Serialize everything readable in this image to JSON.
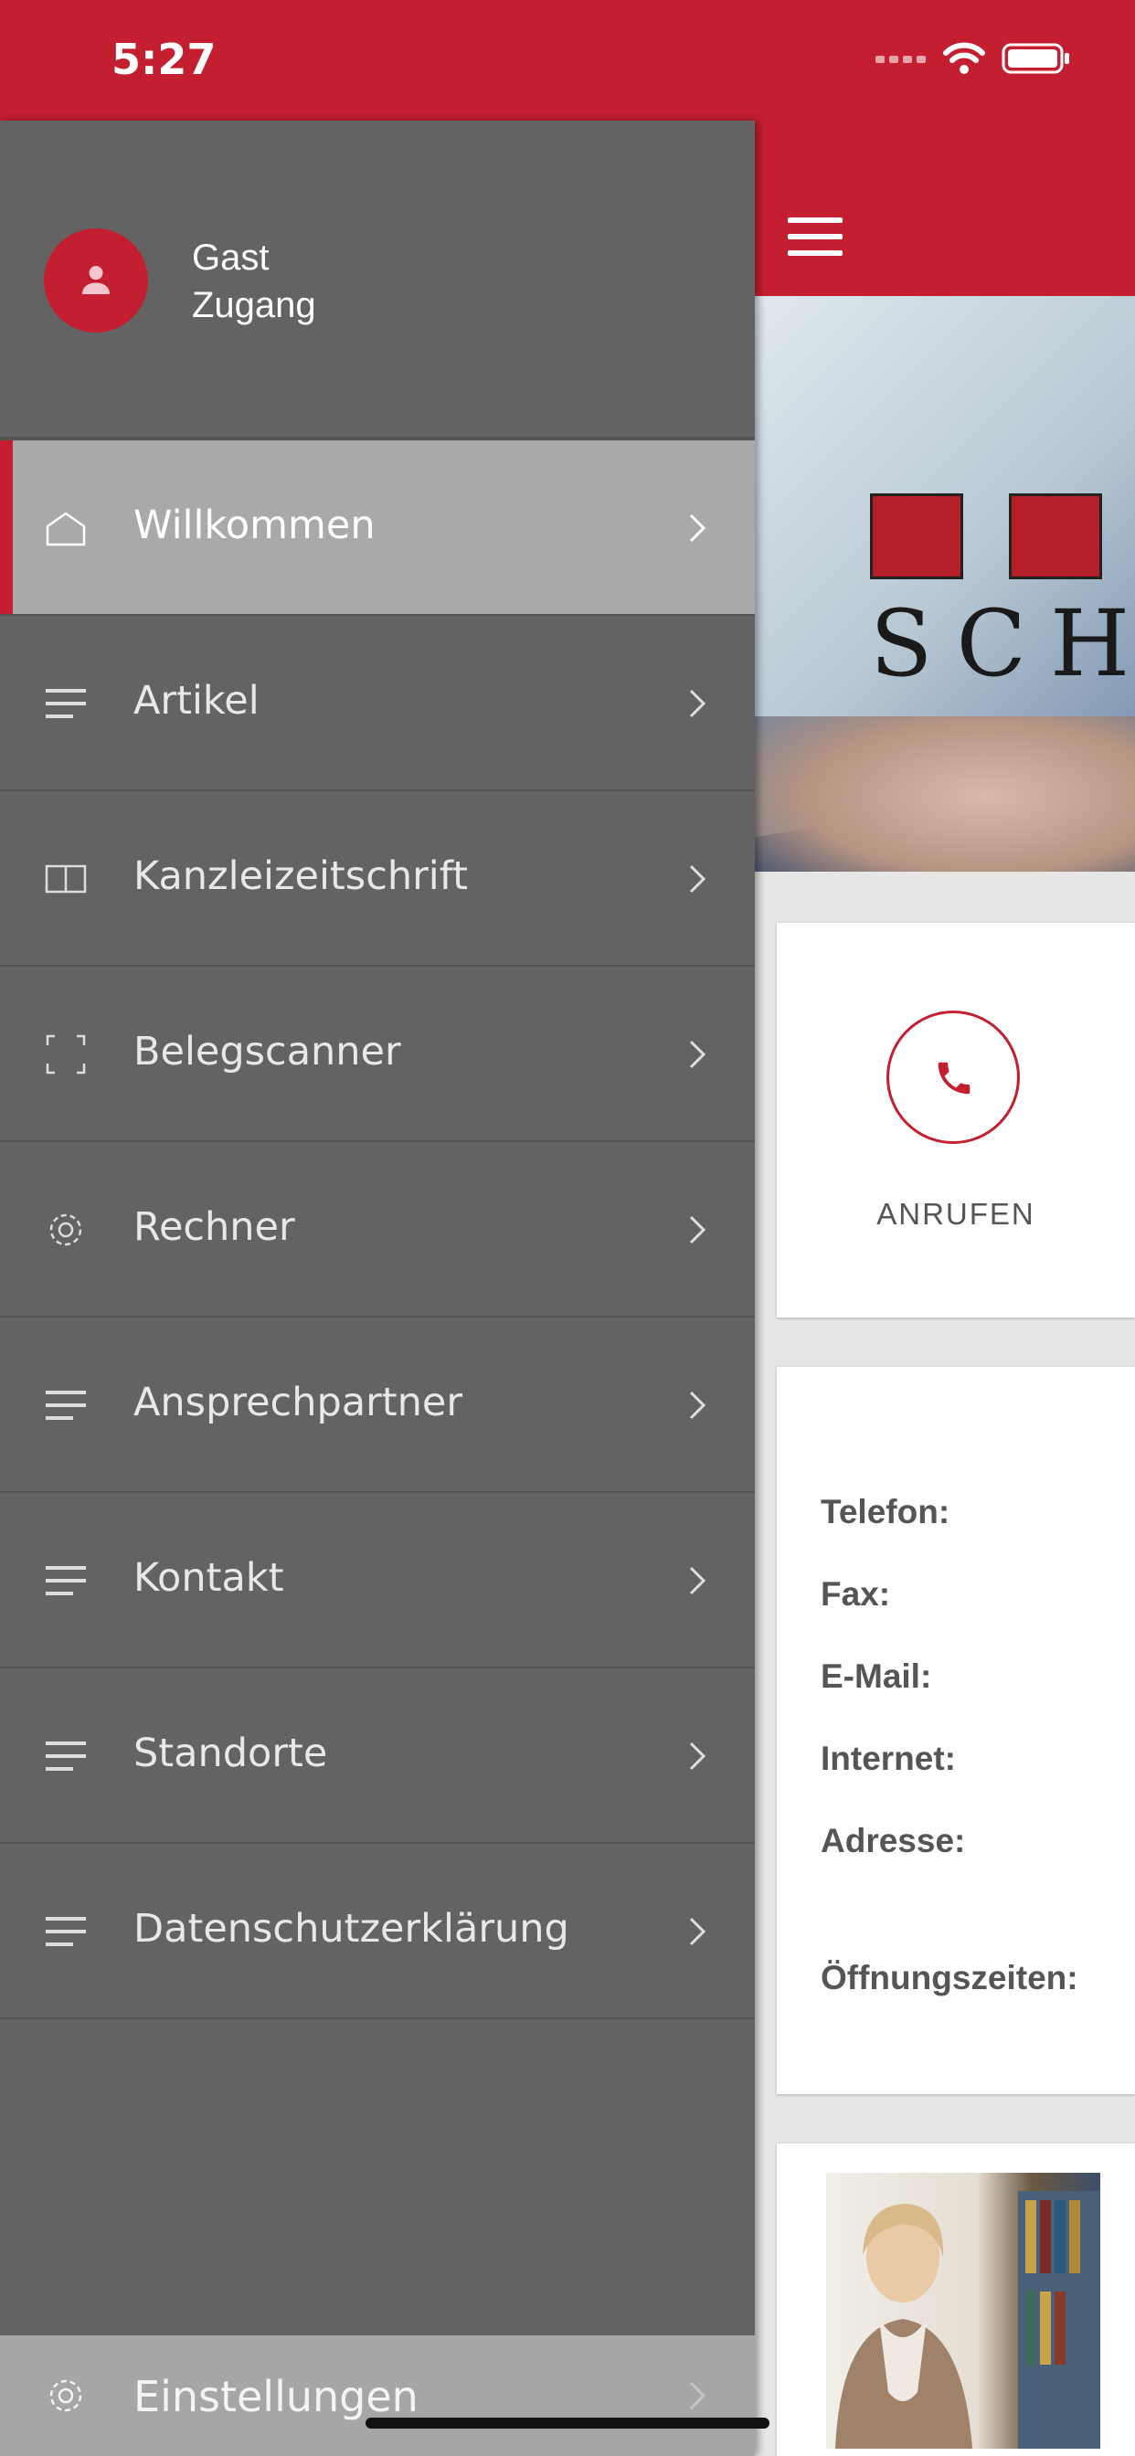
{
  "status_bar": {
    "time": "5:27"
  },
  "drawer": {
    "user": {
      "line1": "Gast",
      "line2": "Zugang"
    },
    "items": [
      {
        "label": "Willkommen",
        "icon": "home-icon",
        "active": true
      },
      {
        "label": "Artikel",
        "icon": "list-icon"
      },
      {
        "label": "Kanzleizeitschrift",
        "icon": "book-icon"
      },
      {
        "label": "Belegscanner",
        "icon": "scan-icon"
      },
      {
        "label": "Rechner",
        "icon": "gear-icon"
      },
      {
        "label": "Ansprechpartner",
        "icon": "list-icon"
      },
      {
        "label": "Kontakt",
        "icon": "list-icon"
      },
      {
        "label": "Standorte",
        "icon": "list-icon"
      },
      {
        "label": "Datenschutzerklärung",
        "icon": "list-icon"
      }
    ],
    "settings": {
      "label": "Einstellungen",
      "icon": "gear-icon"
    }
  },
  "main": {
    "hero_text": "SCHN",
    "call": {
      "label": "ANRUFEN"
    },
    "info": {
      "phone_label": "Telefon:",
      "fax_label": "Fax:",
      "email_label": "E-Mail:",
      "internet_label": "Internet:",
      "address_label": "Adresse:",
      "hours_label": "Öffnungszeiten:"
    }
  },
  "colors": {
    "accent": "#c41f30",
    "drawer_bg": "#636363",
    "active_item": "#a9a9a9"
  }
}
